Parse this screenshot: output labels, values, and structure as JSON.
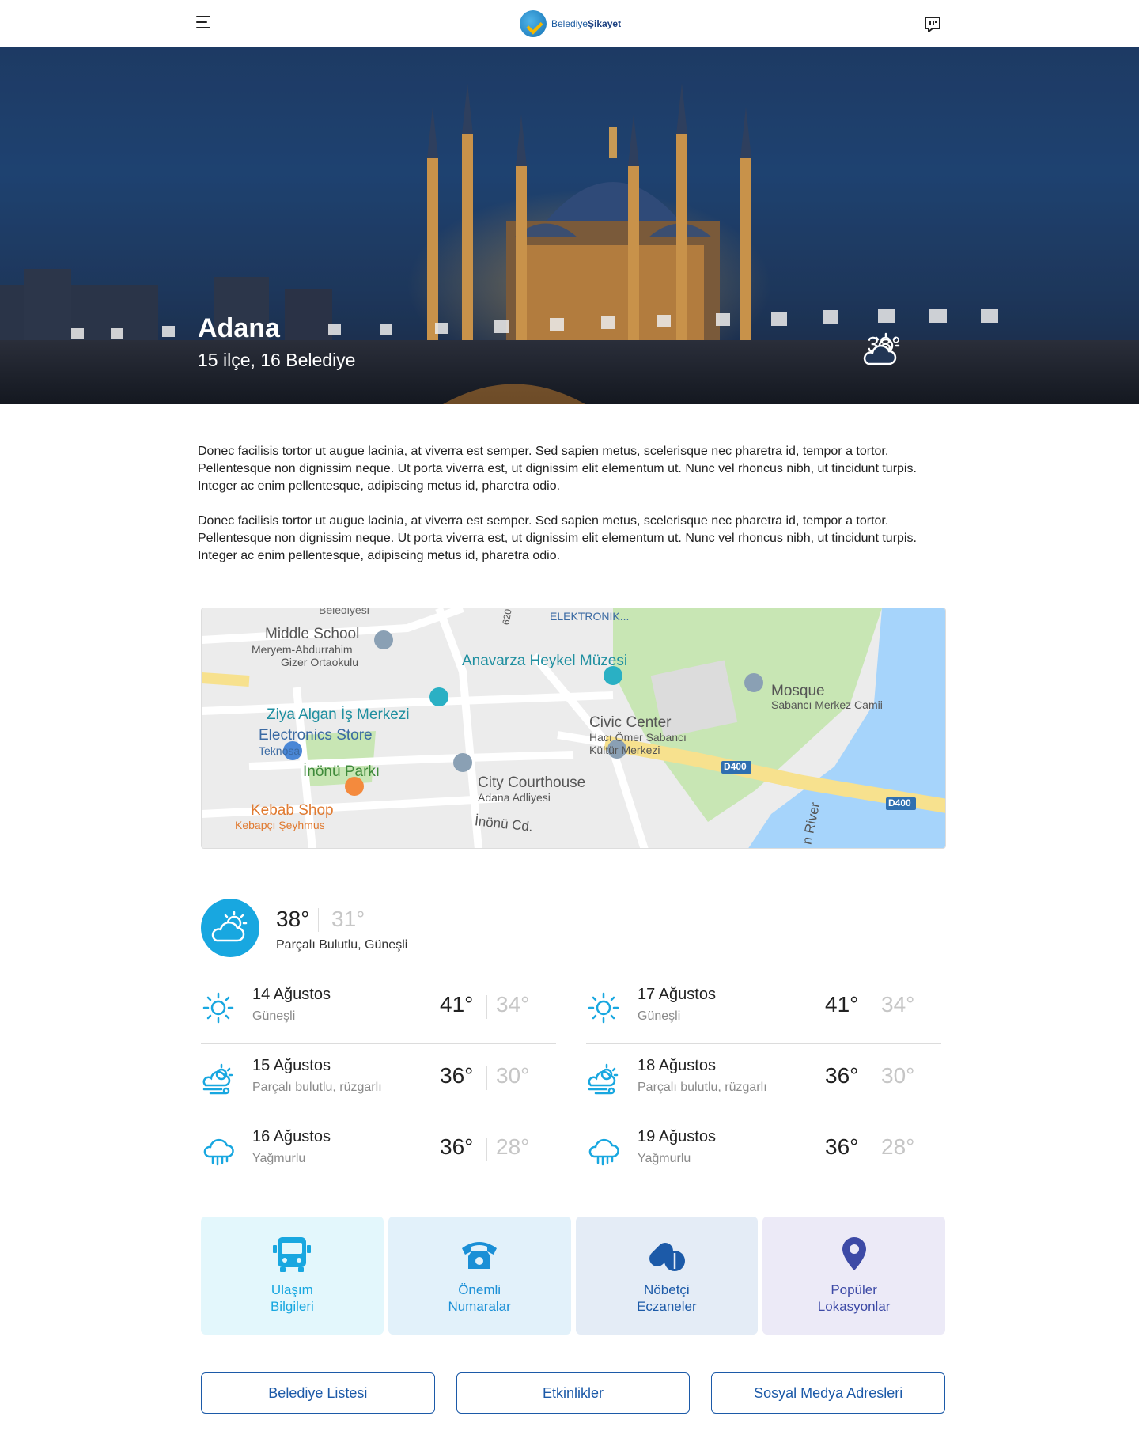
{
  "header": {
    "logo_prefix": "Belediye",
    "logo_bold": "Şikayet",
    "menu_icon": "hamburger-menu-icon",
    "chat_icon": "chat-bubble-icon"
  },
  "hero": {
    "city": "Adana",
    "subtitle": "15 ilçe, 16 Belediye",
    "temperature": "38°",
    "weather_icon": "partly-sunny-icon"
  },
  "intro": {
    "paragraphs": [
      "Donec facilisis tortor ut augue lacinia, at viverra est semper. Sed sapien metus, scelerisque nec pharetra id, tempor a tortor. Pellentesque non dignissim neque. Ut porta viverra est, ut dignissim elit elementum ut. Nunc vel rhoncus nibh, ut tincidunt turpis. Integer ac enim pellentesque, adipiscing metus id, pharetra odio.",
      "Donec facilisis tortor ut augue lacinia, at viverra est semper. Sed sapien metus, scelerisque nec pharetra id, tempor a tortor. Pellentesque non dignissim neque. Ut porta viverra est, ut dignissim elit elementum ut. Nunc vel rhoncus nibh, ut tincidunt turpis. Integer ac enim pellentesque, adipiscing metus id, pharetra odio."
    ]
  },
  "map": {
    "labels": {
      "belediyesi": "Belediyesi",
      "elektronik": "ELEKTRONİK...",
      "road_620": "620",
      "middle_school": "Middle School",
      "meryem": "Meryem-Abdurrahim",
      "gizer": "Gizer Ortaokulu",
      "anavarza": "Anavarza Heykel Müzesi",
      "mosque": "Mosque",
      "sabanci_camii": "Sabancı Merkez Camii",
      "ziya": "Ziya Algan İş Merkezi",
      "civic": "Civic Center",
      "haci_omer": "Hacı Ömer Sabancı",
      "kultur": "Kültür Merkezi",
      "electronics": "Electronics Store",
      "teknosa": "Teknosa",
      "inonu_parki": "İnönü Parkı",
      "d400_a": "D400",
      "d400_b": "D400",
      "city_courthouse": "City Courthouse",
      "adana_adliyesi": "Adana Adliyesi",
      "kebab": "Kebab Shop",
      "kebapci": "Kebapçı Şeyhmus",
      "inonu_cd": "İnönü Cd.",
      "river": "n River"
    }
  },
  "weather": {
    "current": {
      "high": "38°",
      "low": "31°",
      "description": "Parçalı Bulutlu, Güneşli",
      "icon": "partly-sunny-icon"
    },
    "left": [
      {
        "date": "14 Ağustos",
        "desc": "Güneşli",
        "high": "41°",
        "low": "34°",
        "icon": "sun-icon"
      },
      {
        "date": "15 Ağustos",
        "desc": "Parçalı bulutlu, rüzgarlı",
        "high": "36°",
        "low": "30°",
        "icon": "windy-partly-cloudy-icon"
      },
      {
        "date": "16 Ağustos",
        "desc": "Yağmurlu",
        "high": "36°",
        "low": "28°",
        "icon": "rain-cloud-icon"
      }
    ],
    "right": [
      {
        "date": "17 Ağustos",
        "desc": "Güneşli",
        "high": "41°",
        "low": "34°",
        "icon": "sun-icon"
      },
      {
        "date": "18 Ağustos",
        "desc": "Parçalı bulutlu, rüzgarlı",
        "high": "36°",
        "low": "30°",
        "icon": "windy-partly-cloudy-icon"
      },
      {
        "date": "19 Ağustos",
        "desc": "Yağmurlu",
        "high": "36°",
        "low": "28°",
        "icon": "rain-cloud-icon"
      }
    ]
  },
  "tiles": [
    {
      "label": "Ulaşım\nBilgileri",
      "icon": "bus-icon",
      "bg": "#e3f7fc",
      "color": "#18a7e0"
    },
    {
      "label": "Önemli\nNumaralar",
      "icon": "telephone-icon",
      "bg": "#e2f1fa",
      "color": "#1a8fd6"
    },
    {
      "label": "Nöbetçi\nEczaneler",
      "icon": "pills-icon",
      "bg": "#e4ecf6",
      "color": "#1c5aa8"
    },
    {
      "label": "Popüler\nLokasyonlar",
      "icon": "location-pin-icon",
      "bg": "#eceaf7",
      "color": "#3d4aa6"
    }
  ],
  "buttons": [
    {
      "label": "Belediye Listesi"
    },
    {
      "label": "Etkinlikler"
    },
    {
      "label": "Sosyal Medya Adresleri"
    }
  ],
  "colors": {
    "accent": "#18a7e0",
    "brand": "#1c5aa8",
    "muted_temp": "#c6c6c6"
  }
}
